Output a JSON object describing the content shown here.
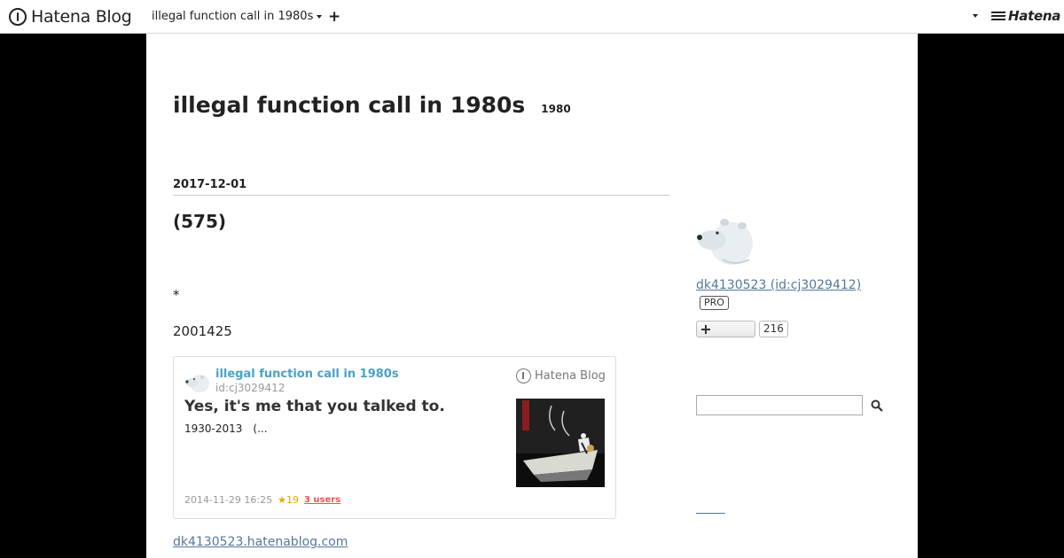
{
  "topbar": {
    "brand": "Hatena Blog",
    "blog_switch": "illegal function call in 1980s",
    "plus": "+",
    "hatena": "Hatena"
  },
  "blog": {
    "title": "illegal function call in 1980s",
    "description": "1980"
  },
  "entry": {
    "date": "2017-12-01",
    "title": "(575)",
    "star_line": "*",
    "text": "2001425",
    "link": "dk4130523.hatenablog.com"
  },
  "embed": {
    "blog_name": "illegal function call in 1980s",
    "user_id": "id:cj3029412",
    "logo_text": "Hatena Blog",
    "headline": "Yes, it's me that you talked to.",
    "summary": "1930-2013　(...",
    "timestamp": "2014-11-29 16:25",
    "stars": "★19",
    "bookmarks": "3 users"
  },
  "sidebar": {
    "profile_name": "dk4130523 (id:cj3029412)",
    "pro_badge": "PRO",
    "reader_count": "216",
    "search_placeholder": ""
  },
  "colors": {
    "accent_link": "#557799",
    "embed_blog_name": "#4aa3c3",
    "star": "#e6a800",
    "bookmark": "#ff4b55"
  },
  "icons": [
    "hatena-blog-logo-icon",
    "caret-down-icon",
    "plus-icon",
    "hatena-logo-icon",
    "polar-bear-avatar-icon",
    "search-icon"
  ]
}
